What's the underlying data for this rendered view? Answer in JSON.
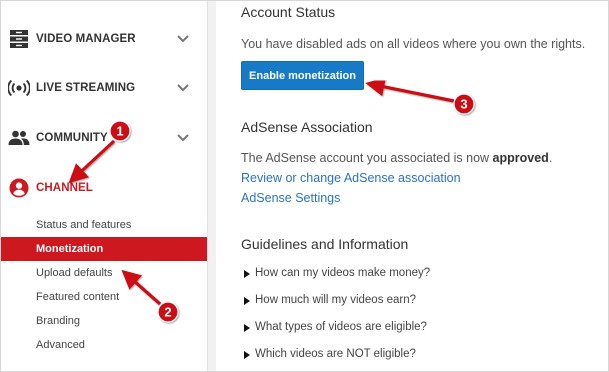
{
  "sidebar": {
    "items": [
      {
        "label": "VIDEO MANAGER",
        "icon": "video-manager-icon"
      },
      {
        "label": "LIVE STREAMING",
        "icon": "live-streaming-icon"
      },
      {
        "label": "COMMUNITY",
        "icon": "community-icon"
      },
      {
        "label": "CHANNEL",
        "icon": "channel-account-icon",
        "active": true
      }
    ],
    "sub_items": [
      {
        "label": "Status and features"
      },
      {
        "label": "Monetization",
        "selected": true
      },
      {
        "label": "Upload defaults"
      },
      {
        "label": "Featured content"
      },
      {
        "label": "Branding"
      },
      {
        "label": "Advanced"
      }
    ]
  },
  "main": {
    "account_status": {
      "heading": "Account Status",
      "text": "You have disabled ads on all videos where you own the rights.",
      "button_label": "Enable monetization"
    },
    "adsense": {
      "heading": "AdSense Association",
      "text_prefix": "The AdSense account you associated is now ",
      "text_bold": "approved",
      "text_suffix": ".",
      "link_review": "Review or change AdSense association",
      "link_settings": "AdSense Settings"
    },
    "guidelines": {
      "heading": "Guidelines and Information",
      "items": [
        "How can my videos make money?",
        "How much will my videos earn?",
        "What types of videos are eligible?",
        "Which videos are NOT eligible?"
      ]
    }
  },
  "annotations": {
    "badges": [
      "1",
      "2",
      "3"
    ],
    "color": "#cc1016"
  },
  "colors": {
    "accent_red": "#cc181e",
    "button_blue": "#167ac6",
    "link_blue": "#2a72c4"
  }
}
